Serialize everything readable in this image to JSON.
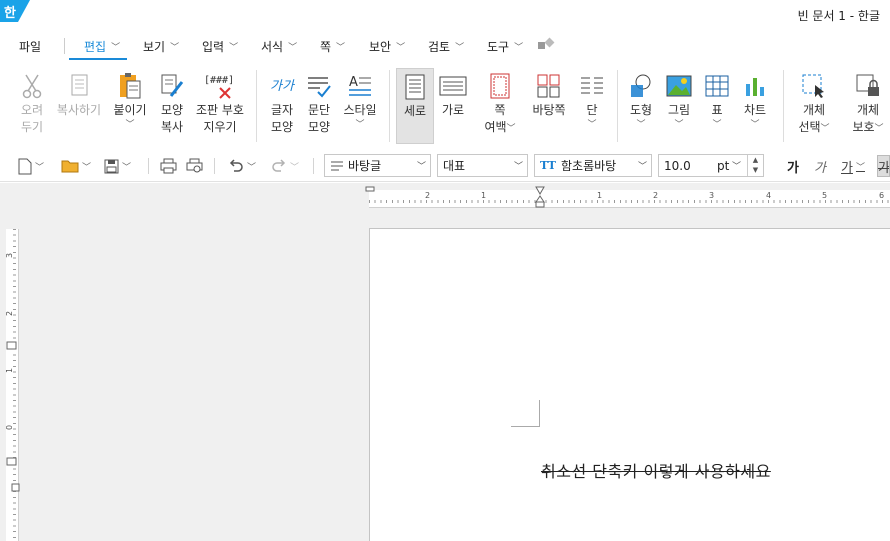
{
  "app": {
    "logo_char": "한",
    "window_title": "빈 문서 1 - 한글"
  },
  "menu": {
    "items": [
      {
        "label": "파일",
        "has_chevron": false
      },
      {
        "label": "편집",
        "has_chevron": true,
        "active": true
      },
      {
        "label": "보기",
        "has_chevron": true
      },
      {
        "label": "입력",
        "has_chevron": true
      },
      {
        "label": "서식",
        "has_chevron": true
      },
      {
        "label": "쪽",
        "has_chevron": true
      },
      {
        "label": "보안",
        "has_chevron": true
      },
      {
        "label": "검토",
        "has_chevron": true
      },
      {
        "label": "도구",
        "has_chevron": true
      }
    ],
    "chevron": "﹀"
  },
  "ribbon": {
    "cut": {
      "line1": "오려",
      "line2": "두기",
      "icon": "scissors-icon"
    },
    "copy": {
      "line1": "복사하기",
      "icon": "copy-icon"
    },
    "paste": {
      "line1": "붙이기",
      "icon": "paste-icon"
    },
    "format_copy": {
      "line1": "모양",
      "line2": "복사",
      "icon": "format-painter-icon"
    },
    "remove_marks": {
      "line1": "조판 부호",
      "line2": "지우기",
      "icon_text": "[###]",
      "icon": "remove-marks-icon"
    },
    "char_shape": {
      "line1": "글자",
      "line2": "모양",
      "icon_text": "가가",
      "icon": "char-shape-icon"
    },
    "para_shape": {
      "line1": "문단",
      "line2": "모양",
      "icon": "para-shape-icon"
    },
    "style": {
      "line1": "스타일",
      "icon": "style-icon"
    },
    "portrait": {
      "line1": "세로",
      "icon": "portrait-icon"
    },
    "landscape": {
      "line1": "가로",
      "icon": "landscape-icon"
    },
    "margin": {
      "line1": "쪽",
      "line2": "여백",
      "icon": "page-margin-icon"
    },
    "background": {
      "line1": "바탕쪽",
      "icon": "master-page-icon"
    },
    "columns": {
      "line1": "단",
      "icon": "columns-icon"
    },
    "shape": {
      "line1": "도형",
      "icon": "shape-icon"
    },
    "picture": {
      "line1": "그림",
      "icon": "picture-icon"
    },
    "table": {
      "line1": "표",
      "icon": "table-icon"
    },
    "chart": {
      "line1": "차트",
      "icon": "chart-icon"
    },
    "select_obj": {
      "line1": "개체",
      "line2": "선택",
      "icon": "object-select-icon"
    },
    "protect_obj": {
      "line1": "개체",
      "line2": "보호",
      "icon": "object-protect-icon"
    }
  },
  "toolbar": {
    "style_combo": "바탕글",
    "lang_combo": "대표",
    "font_combo": "함초롬바탕",
    "font_icon": "TT",
    "size_value": "10.0",
    "size_unit": "pt",
    "bold_label": "가",
    "italic_label": "가",
    "underline_label": "가",
    "extra_label": "가"
  },
  "ruler": {
    "h_numbers": [
      "2",
      "1",
      "1",
      "2",
      "3",
      "4",
      "5",
      "6"
    ],
    "v_numbers": [
      "3",
      "2",
      "1",
      "0"
    ]
  },
  "document": {
    "text": "취소선 단축키 이렇게 사용하세요"
  }
}
